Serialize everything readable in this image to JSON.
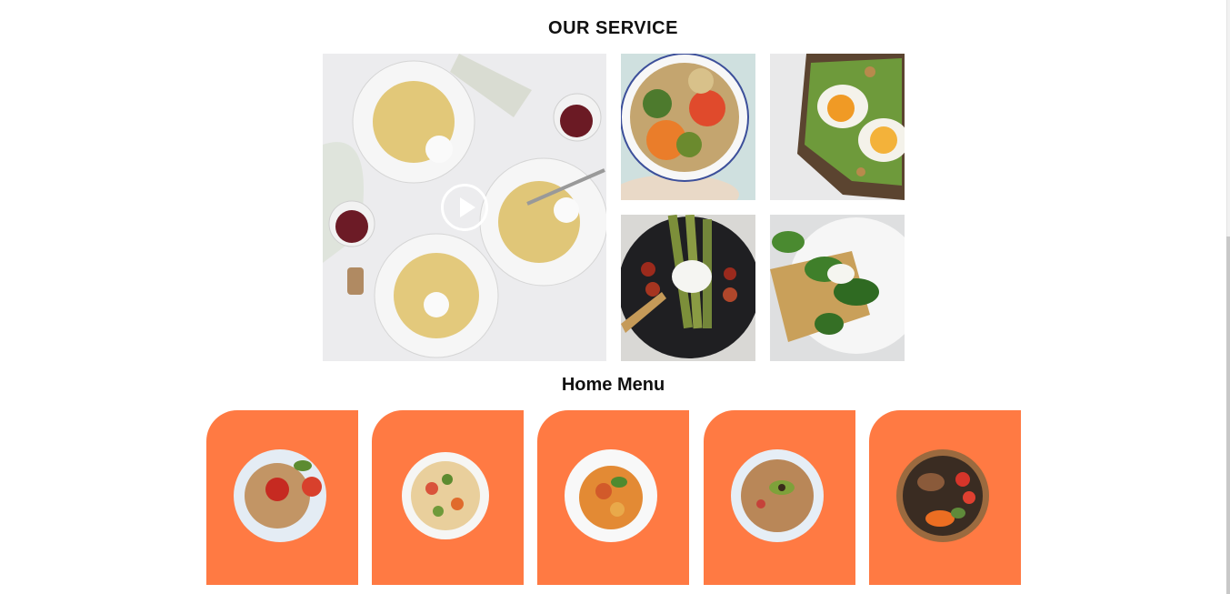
{
  "service": {
    "title": "OUR SERVICE"
  },
  "menu": {
    "title": "Home Menu"
  },
  "icons": {
    "play": "play-icon"
  },
  "colors": {
    "accent": "#ff7a43",
    "text": "#111111",
    "background": "#ffffff"
  }
}
